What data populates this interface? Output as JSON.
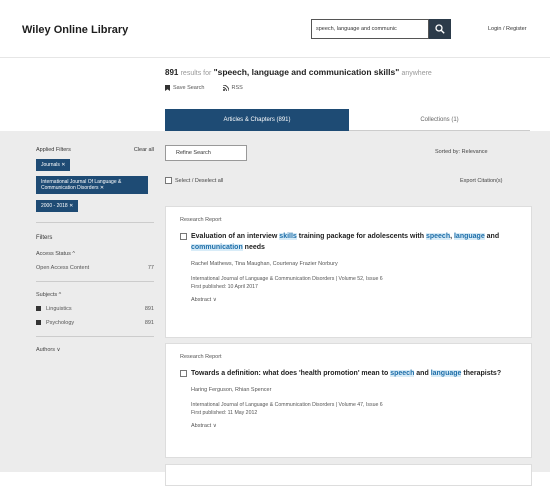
{
  "header": {
    "logo": "Wiley Online Library",
    "search_value": "speech, language and communic",
    "login": "Login / Register"
  },
  "results": {
    "count": "891",
    "results_for": "results for",
    "query": "\"speech, language and communication skills\"",
    "anywhere": "anywhere",
    "save_search": "Save Search",
    "rss": "RSS"
  },
  "tabs": {
    "active": "Articles & Chapters (891)",
    "inactive": "Collections (1)"
  },
  "sidebar": {
    "applied_filters": "Applied Filters",
    "clear_all": "Clear all",
    "chips": [
      "Journals ✕",
      "International Journal Of Language & Communication Disorders ✕",
      "2000 - 2018 ✕"
    ],
    "filters": "Filters",
    "access_status": "Access Status ^",
    "open_access": "Open Access Content",
    "open_access_count": "77",
    "subjects": "Subjects ^",
    "subject_items": [
      {
        "label": "Linguistics",
        "count": "891"
      },
      {
        "label": "Psychology",
        "count": "891"
      }
    ],
    "authors": "Authors ∨"
  },
  "toolbar": {
    "refine": "Refine Search",
    "sort": "Sorted by: Relevance",
    "select_all": "Select / Deselect all",
    "export": "Export Citation(s)"
  },
  "articles": [
    {
      "type": "Research Report",
      "title_parts": [
        {
          "t": "Evaluation of an interview ",
          "h": false
        },
        {
          "t": "skills",
          "h": true
        },
        {
          "t": " training package for adolescents with ",
          "h": false
        },
        {
          "t": "speech",
          "h": true
        },
        {
          "t": ", ",
          "h": false
        },
        {
          "t": "language",
          "h": true
        },
        {
          "t": " and ",
          "h": false
        },
        {
          "t": "communication",
          "h": true
        },
        {
          "t": " needs",
          "h": false
        }
      ],
      "authors": "Rachel Mathews, Tina Maughan, Courtenay Frazier Norbury",
      "journal": "International Journal of Language & Communication Disorders | Volume 52, Issue 6",
      "published": "First published: 10 April 2017",
      "abstract": "Abstract ∨"
    },
    {
      "type": "Research Report",
      "title_parts": [
        {
          "t": "Towards a definition: what does 'health promotion' mean to ",
          "h": false
        },
        {
          "t": "speech",
          "h": true
        },
        {
          "t": " and ",
          "h": false
        },
        {
          "t": "language",
          "h": true
        },
        {
          "t": " therapists?",
          "h": false
        }
      ],
      "authors": "Haring Ferguson, Rhian Spencer",
      "journal": "International Journal of Language & Communication Disorders | Volume 47, Issue 6",
      "published": "First published: 11 May 2012",
      "abstract": "Abstract ∨"
    }
  ],
  "colors": {
    "brand": "#1e4b74",
    "highlight_bg": "#d8ecf8",
    "highlight_text": "#1e6ea8",
    "page_bg": "#ececec"
  }
}
